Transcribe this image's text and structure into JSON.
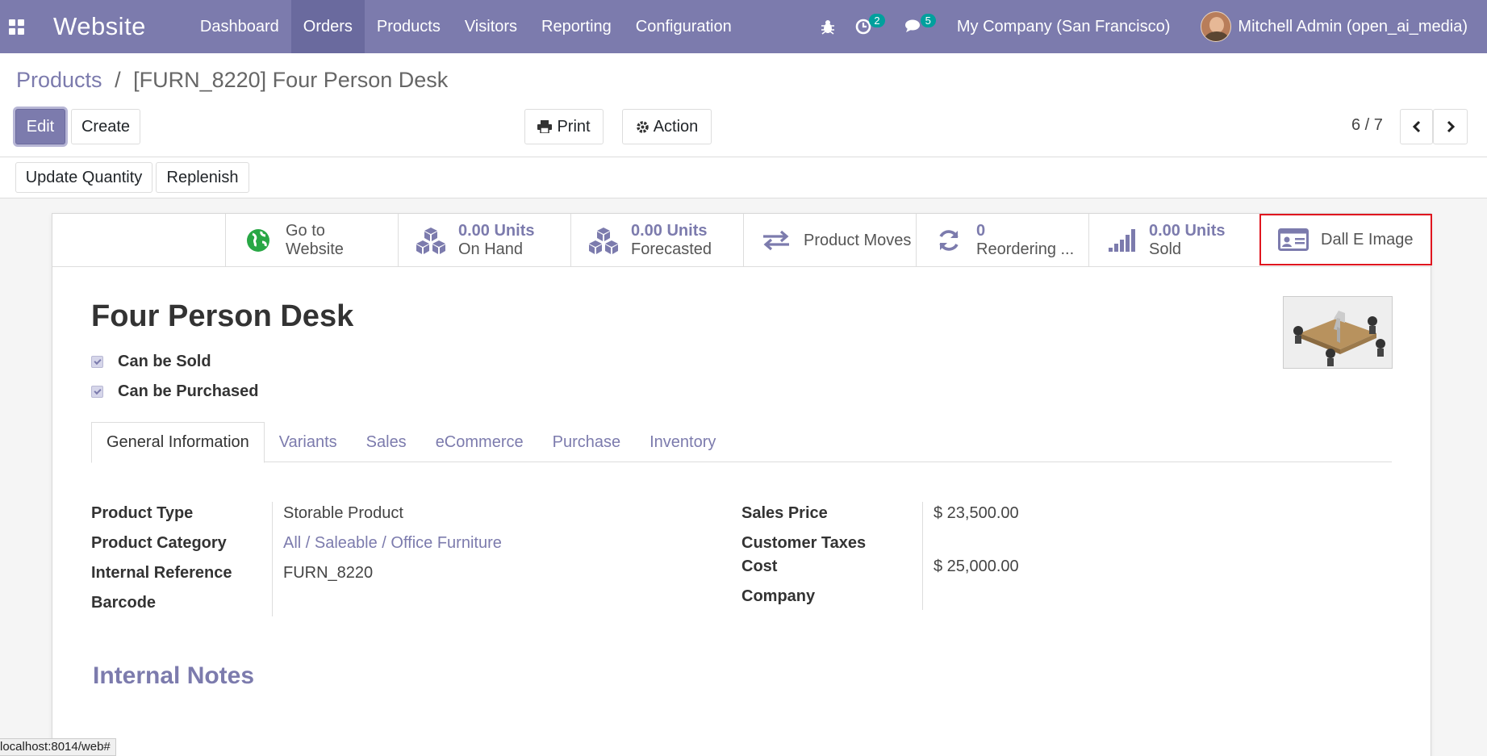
{
  "navbar": {
    "brand": "Website",
    "menu": [
      "Dashboard",
      "Orders",
      "Products",
      "Visitors",
      "Reporting",
      "Configuration"
    ],
    "active_index": 1,
    "activity_count": "2",
    "message_count": "5",
    "company": "My Company (San Francisco)",
    "user": "Mitchell Admin (open_ai_media)"
  },
  "breadcrumb": {
    "parent": "Products",
    "separator": "/",
    "current": "[FURN_8220] Four Person Desk"
  },
  "buttons": {
    "edit": "Edit",
    "create": "Create",
    "print": "Print",
    "action": "Action",
    "update_quantity": "Update Quantity",
    "replenish": "Replenish"
  },
  "pager": {
    "text": "6 / 7"
  },
  "smart_buttons": {
    "website": {
      "line1": "Go to",
      "line2": "Website"
    },
    "on_hand": {
      "value": "0.00 Units",
      "label": "On Hand"
    },
    "forecasted": {
      "value": "0.00 Units",
      "label": "Forecasted"
    },
    "moves": {
      "label": "Product Moves"
    },
    "reordering": {
      "value": "0",
      "label": "Reordering ..."
    },
    "sold": {
      "value": "0.00 Units",
      "label": "Sold"
    },
    "dalle": {
      "label": "Dall E Image"
    }
  },
  "product": {
    "name": "Four Person Desk",
    "can_be_sold": "Can be Sold",
    "can_be_purchased": "Can be Purchased"
  },
  "tabs": [
    "General Information",
    "Variants",
    "Sales",
    "eCommerce",
    "Purchase",
    "Inventory"
  ],
  "fields_left": [
    {
      "label": "Product Type",
      "value": "Storable Product"
    },
    {
      "label": "Product Category",
      "value": "All / Saleable / Office Furniture"
    },
    {
      "label": "Internal Reference",
      "value": "FURN_8220"
    },
    {
      "label": "Barcode",
      "value": ""
    }
  ],
  "fields_right": [
    {
      "label": "Sales Price",
      "value": "$ 23,500.00"
    },
    {
      "label": "Customer Taxes",
      "value": ""
    },
    {
      "label": "Cost",
      "value": "$ 25,000.00"
    },
    {
      "label": "Company",
      "value": ""
    }
  ],
  "notes_title": "Internal Notes",
  "status_url": "localhost:8014/web#",
  "colors": {
    "primary": "#7c7bad",
    "highlight": "#e0161f"
  }
}
